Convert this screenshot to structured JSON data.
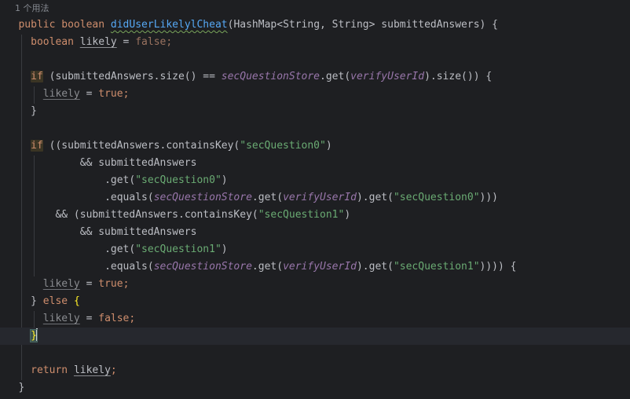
{
  "editor": {
    "usage_hint": "1 个用法",
    "lines": {
      "l1": {
        "kw_public": "public",
        "kw_boolean": "boolean",
        "method": "didUserLikelylCheat",
        "params": "(HashMap<String, String> submittedAnswers) {"
      },
      "l2": {
        "kw_boolean": "boolean",
        "var": "likely",
        "eq": " = ",
        "lit": "false",
        "semi": ";"
      },
      "l4": {
        "kw_if": "if",
        "a": " (submittedAnswers.size() == ",
        "field": "secQuestionStore",
        "b": ".get(",
        "field2": "verifyUserId",
        "c": ").size()) {"
      },
      "l5": {
        "var": "likely",
        "eq": " = ",
        "lit": "true",
        "semi": ";"
      },
      "l6": {
        "brace": "}"
      },
      "l8": {
        "kw_if": "if",
        "a": " ((submittedAnswers.containsKey(",
        "str": "\"secQuestion0\"",
        "b": ")"
      },
      "l9": {
        "a": "&& submittedAnswers"
      },
      "l10": {
        "a": ".get(",
        "str": "\"secQuestion0\"",
        "b": ")"
      },
      "l11": {
        "a": ".equals(",
        "field": "secQuestionStore",
        "b": ".get(",
        "field2": "verifyUserId",
        "c": ").get(",
        "str": "\"secQuestion0\"",
        "d": ")))"
      },
      "l12": {
        "a": "&& (submittedAnswers.containsKey(",
        "str": "\"secQuestion1\"",
        "b": ")"
      },
      "l13": {
        "a": "&& submittedAnswers"
      },
      "l14": {
        "a": ".get(",
        "str": "\"secQuestion1\"",
        "b": ")"
      },
      "l15": {
        "a": ".equals(",
        "field": "secQuestionStore",
        "b": ".get(",
        "field2": "verifyUserId",
        "c": ").get(",
        "str": "\"secQuestion1\"",
        "d": ")))) {"
      },
      "l16": {
        "var": "likely",
        "eq": " = ",
        "lit": "true",
        "semi": ";"
      },
      "l17": {
        "brace": "}",
        "kw_else": "else",
        "brace2": "{"
      },
      "l18": {
        "var": "likely",
        "eq": " = ",
        "lit": "false",
        "semi": ";"
      },
      "l19": {
        "brace": "}"
      },
      "l21": {
        "kw_return": "return",
        "var": "likely",
        "semi": ";"
      },
      "l22": {
        "brace": "}"
      }
    }
  },
  "colors": {
    "background": "#1e1f22",
    "keyword": "#cf8e6d",
    "method": "#56a8f5",
    "string": "#6aab73",
    "field": "#9876aa",
    "text": "#bcbec4",
    "brace_match": "#ffef28"
  }
}
